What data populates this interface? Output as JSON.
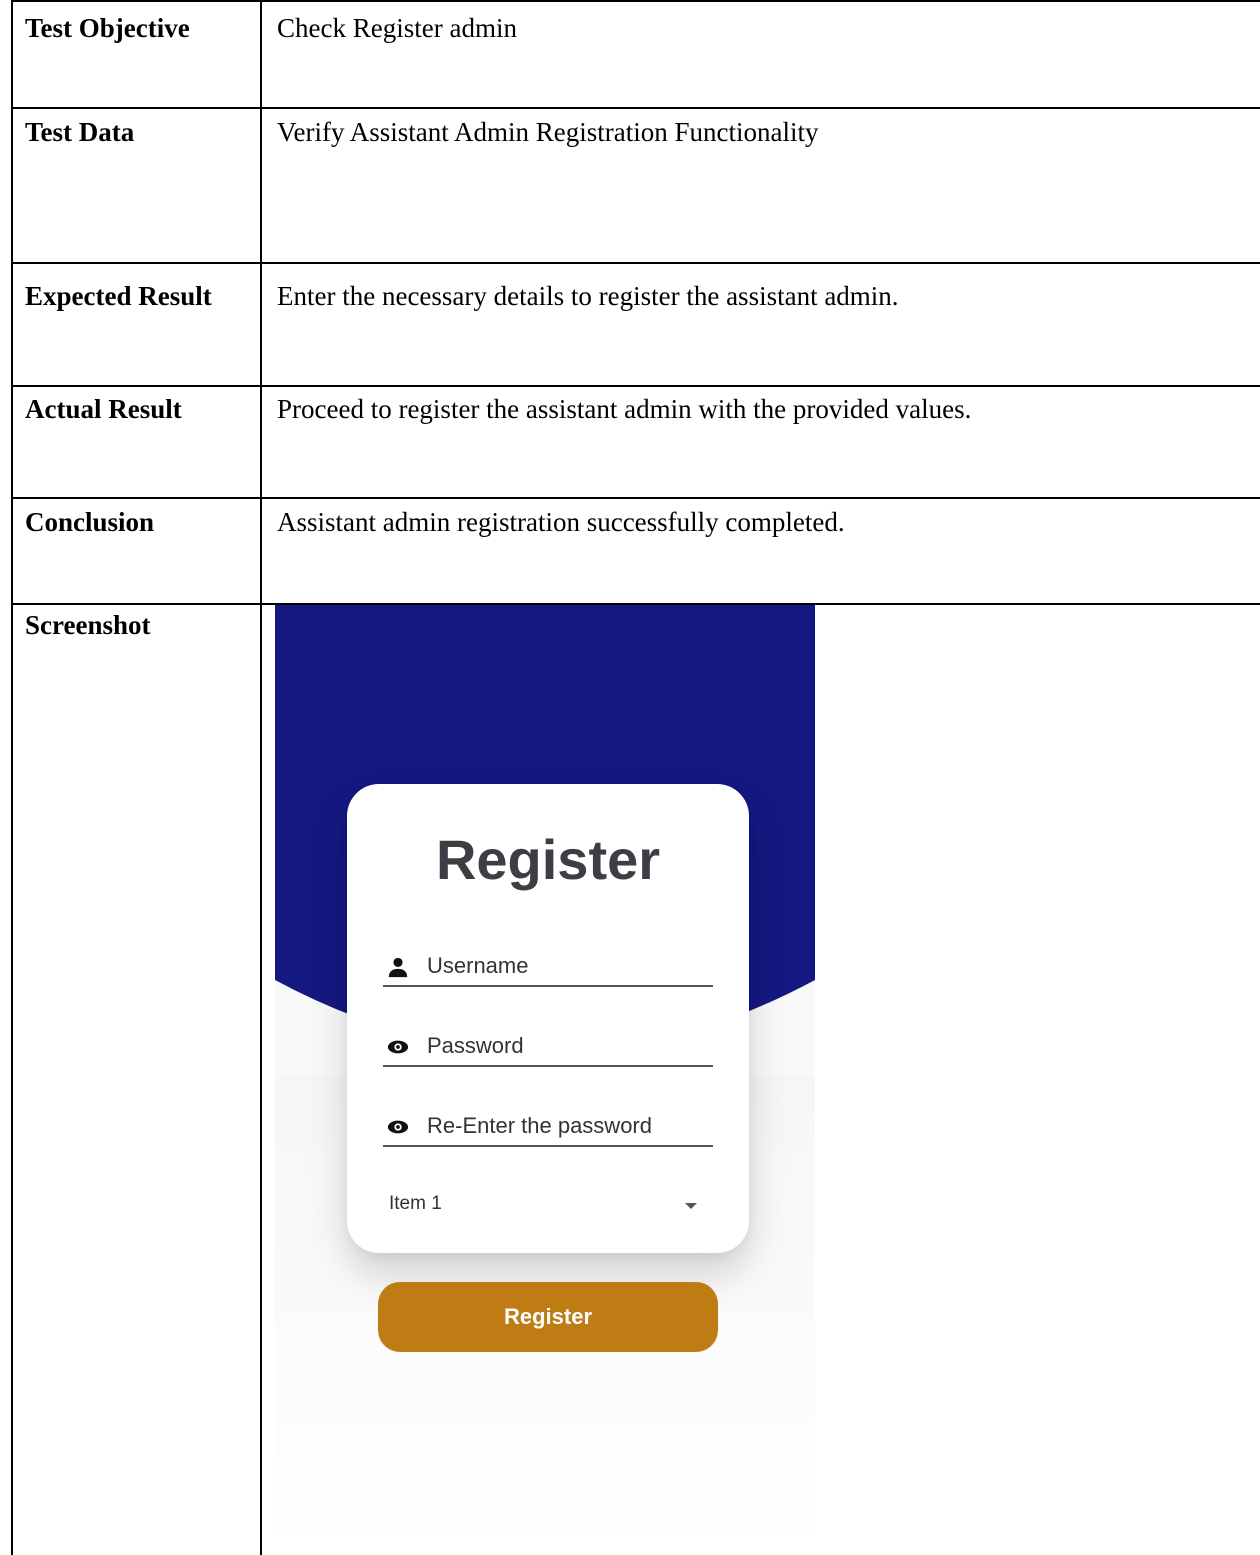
{
  "rows": [
    {
      "label": "Test Objective",
      "value": "Check Register admin"
    },
    {
      "label": "Test Data",
      "value": "Verify Assistant Admin Registration Functionality"
    },
    {
      "label": "Expected Result",
      "value": "Enter the necessary details to register the assistant admin."
    },
    {
      "label": "Actual Result",
      "value": "Proceed to register the assistant admin with the provided values."
    },
    {
      "label": "Conclusion",
      "value": "Assistant admin registration successfully completed."
    },
    {
      "label": "Screenshot"
    }
  ],
  "screenshot": {
    "title": "Register",
    "username_placeholder": "Username",
    "password_placeholder": "Password",
    "reenter_placeholder": "Re-Enter the password",
    "dropdown_value": "Item 1",
    "button_label": "Register",
    "colors": {
      "header": "#151880",
      "button": "#bf7c14",
      "title_text": "#3d3d44"
    },
    "icons": {
      "username": "person-icon",
      "password": "eye-icon",
      "reenter": "eye-icon",
      "dropdown": "caret-down-icon"
    }
  }
}
